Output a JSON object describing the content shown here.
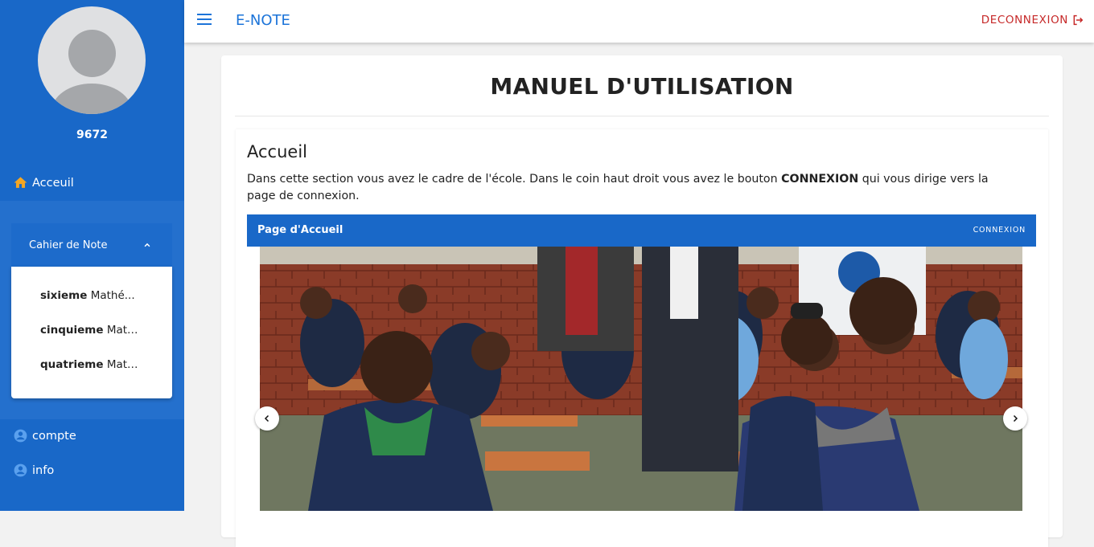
{
  "sidebar": {
    "username": "9672",
    "home_label": "Acceuil",
    "group_label": "Cahier de Note",
    "submenu": [
      {
        "level": "sixieme",
        "subject": "Mathé..."
      },
      {
        "level": "cinquieme",
        "subject": "Math..."
      },
      {
        "level": "quatrieme",
        "subject": "Math..."
      }
    ],
    "compte_label": "compte",
    "info_label": "info"
  },
  "topbar": {
    "app_title": "E-NOTE",
    "logout_label": "DECONNEXION"
  },
  "main": {
    "page_title": "MANUEL D'UTILISATION",
    "section_title": "Accueil",
    "text_before": "Dans cette section vous avez le cadre de l'école. Dans le coin haut droit vous avez le bouton ",
    "text_bold": "CONNEXION",
    "text_after": " qui vous dirige vers la page de connexion.",
    "preview_title": "Page d'Accueil",
    "preview_action": "CONNEXION"
  },
  "colors": {
    "sidebar": "#1968c8",
    "accent": "#1c74d9",
    "logout": "#c62828",
    "home_icon": "#f5a623"
  },
  "icons": [
    "menu-icon",
    "logout-icon",
    "home-icon",
    "chevron-up-icon",
    "account-circle-icon",
    "chevron-left-icon",
    "chevron-right-icon"
  ]
}
